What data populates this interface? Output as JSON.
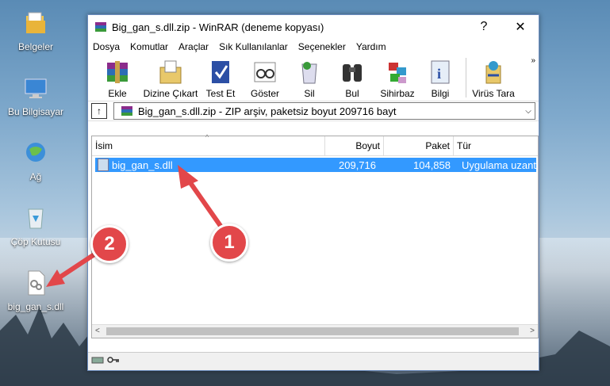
{
  "desktop": {
    "icons": [
      {
        "label": "Belgeler",
        "icon": "folder-documents-icon"
      },
      {
        "label": "Bu Bilgisayar",
        "icon": "computer-icon"
      },
      {
        "label": "Ağ",
        "icon": "network-icon"
      },
      {
        "label": "Çöp Kutusu",
        "icon": "recycle-bin-icon"
      },
      {
        "label": "big_gan_s.dll",
        "icon": "dll-file-icon"
      }
    ]
  },
  "window": {
    "title": "Big_gan_s.dll.zip - WinRAR (deneme kopyası)",
    "help_label": "?",
    "close_label": "✕"
  },
  "menu": [
    "Dosya",
    "Komutlar",
    "Araçlar",
    "Sık Kullanılanlar",
    "Seçenekler",
    "Yardım"
  ],
  "toolbar": {
    "buttons": [
      "Ekle",
      "Dizine Çıkart",
      "Test Et",
      "Göster",
      "Sil",
      "Bul",
      "Sihirbaz",
      "Bilgi",
      "Virüs Tara"
    ],
    "more": "»"
  },
  "address": {
    "text": "Big_gan_s.dll.zip - ZIP arşiv, paketsiz boyut 209716 bayt",
    "up_label": "↑",
    "dropdown": "⌵"
  },
  "columns": [
    "İsim",
    "Boyut",
    "Paket",
    "Tür"
  ],
  "files": [
    {
      "name": "big_gan_s.dll",
      "size": "209,716",
      "packed": "104,858",
      "type": "Uygulama uzantısı"
    }
  ],
  "badges": {
    "one": "1",
    "two": "2"
  },
  "colors": {
    "selection": "#3399ff",
    "badge": "#e2474a"
  }
}
